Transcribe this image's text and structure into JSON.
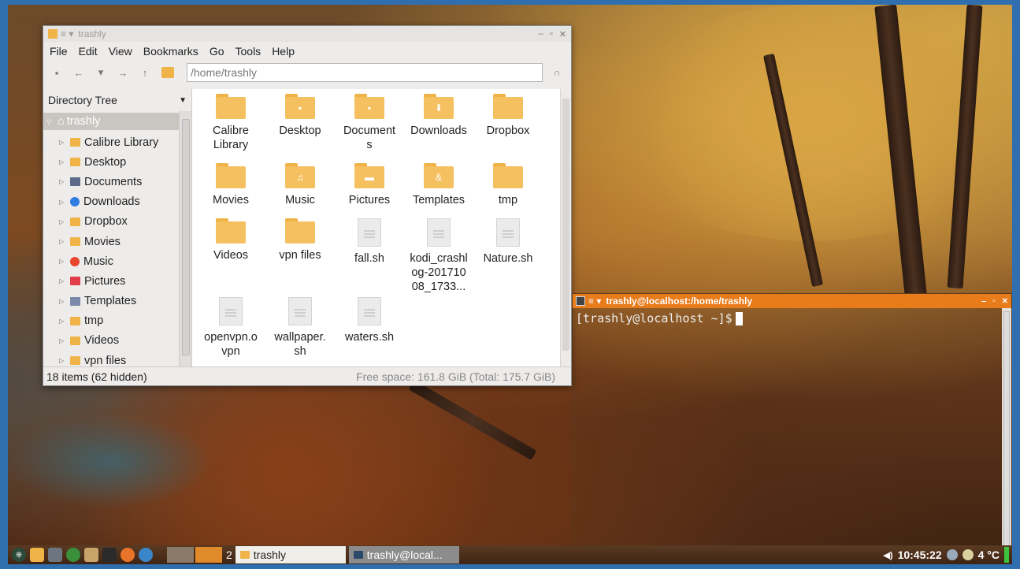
{
  "file_manager": {
    "title": "trashly",
    "menu": [
      "File",
      "Edit",
      "View",
      "Bookmarks",
      "Go",
      "Tools",
      "Help"
    ],
    "address": "/home/trashly",
    "side_panel_label": "Directory Tree",
    "tree": {
      "root": "trashly",
      "items": [
        {
          "label": "Calibre Library",
          "icon": "folder-icon",
          "color": "#f0b347"
        },
        {
          "label": "Desktop",
          "icon": "folder-icon",
          "color": "#f0b347"
        },
        {
          "label": "Documents",
          "icon": "documents-icon",
          "color": "#5c6b8a"
        },
        {
          "label": "Downloads",
          "icon": "downloads-icon",
          "color": "#2f7de1"
        },
        {
          "label": "Dropbox",
          "icon": "folder-icon",
          "color": "#f0b347"
        },
        {
          "label": "Movies",
          "icon": "folder-icon",
          "color": "#f0b347"
        },
        {
          "label": "Music",
          "icon": "music-icon",
          "color": "#e8452c"
        },
        {
          "label": "Pictures",
          "icon": "pictures-icon",
          "color": "#e23b4a"
        },
        {
          "label": "Templates",
          "icon": "templates-icon",
          "color": "#7a8aa8"
        },
        {
          "label": "tmp",
          "icon": "folder-icon",
          "color": "#f0b347"
        },
        {
          "label": "Videos",
          "icon": "folder-icon",
          "color": "#f0b347"
        },
        {
          "label": "vpn files",
          "icon": "folder-icon",
          "color": "#f0b347"
        }
      ]
    },
    "files": [
      {
        "name": "Calibre\nLibrary",
        "type": "folder",
        "glyph": ""
      },
      {
        "name": "Desktop",
        "type": "folder",
        "glyph": "▪"
      },
      {
        "name": "Document\ns",
        "type": "folder",
        "glyph": "▪"
      },
      {
        "name": "Downloads",
        "type": "folder",
        "glyph": "⬇"
      },
      {
        "name": "Dropbox",
        "type": "folder",
        "glyph": ""
      },
      {
        "name": "Movies",
        "type": "folder",
        "glyph": ""
      },
      {
        "name": "Music",
        "type": "folder",
        "glyph": "♫"
      },
      {
        "name": "Pictures",
        "type": "folder",
        "glyph": "▬"
      },
      {
        "name": "Templates",
        "type": "folder",
        "glyph": "&"
      },
      {
        "name": "tmp",
        "type": "folder",
        "glyph": ""
      },
      {
        "name": "Videos",
        "type": "folder",
        "glyph": ""
      },
      {
        "name": "vpn files",
        "type": "folder",
        "glyph": ""
      },
      {
        "name": "fall.sh",
        "type": "file",
        "glyph": ""
      },
      {
        "name": "kodi_crashl\nog-201710\n08_1733...",
        "type": "file",
        "glyph": ""
      },
      {
        "name": "Nature.sh",
        "type": "file",
        "glyph": ""
      },
      {
        "name": "openvpn.o\nvpn",
        "type": "file",
        "glyph": ""
      },
      {
        "name": "wallpaper.\nsh",
        "type": "file",
        "glyph": ""
      },
      {
        "name": "waters.sh",
        "type": "file",
        "glyph": ""
      }
    ],
    "status_left": "18 items (62 hidden)",
    "status_right": "Free space: 161.8 GiB (Total: 175.7 GiB)"
  },
  "terminal": {
    "title": "trashly@localhost:/home/trashly",
    "prompt": "[trashly@localhost ~]$"
  },
  "taskbar": {
    "workspace_number": "2",
    "tasks": [
      {
        "label": "trashly",
        "icon": "folder-icon"
      },
      {
        "label": "trashly@local...",
        "icon": "terminal-icon"
      }
    ],
    "clock": "10:45:22",
    "temperature": "4 °C"
  }
}
